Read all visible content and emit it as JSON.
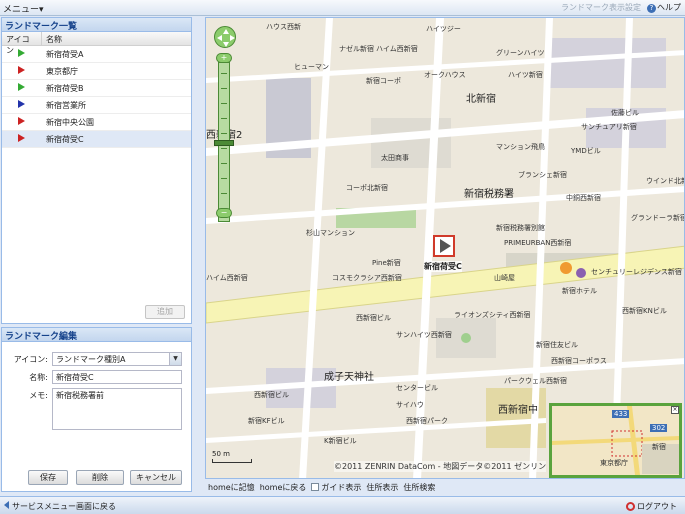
{
  "menubar": {
    "menu_label": "メニュー▾",
    "landmark_settings": "ランドマーク表示設定",
    "help": "ヘルプ",
    "help_glyph": "?"
  },
  "landmark_list": {
    "title": "ランドマーク一覧",
    "col_icon": "アイコン",
    "col_name": "名称",
    "rows": [
      {
        "name": "新宿荷受A",
        "color": "#33aa33"
      },
      {
        "name": "東京都庁",
        "color": "#cc2222"
      },
      {
        "name": "新宿荷受B",
        "color": "#33aa33"
      },
      {
        "name": "新宿営業所",
        "color": "#2233aa"
      },
      {
        "name": "新宿中央公園",
        "color": "#cc2222"
      },
      {
        "name": "新宿荷受C",
        "color": "#cc2222"
      }
    ],
    "add_button": "追加"
  },
  "landmark_edit": {
    "title": "ランドマーク編集",
    "icon_label": "アイコン:",
    "icon_value": "ランドマーク種別A",
    "name_label": "名称:",
    "name_value": "新宿荷受C",
    "memo_label": "メモ:",
    "memo_value": "新宿税務署前",
    "save": "保存",
    "delete": "削除",
    "cancel": "キャンセル"
  },
  "map": {
    "marker_label": "新宿荷受C",
    "copyright": "©2011 ZENRIN DataCom - 地図データ©2011 ゼンリン",
    "scale": "50 m",
    "overview_number1": "433",
    "overview_number2": "302",
    "overview_label1": "東京都庁",
    "overview_label2": "新宿",
    "overview_close": "×",
    "labels": {
      "l1": "新宿税務署",
      "l2": "西新宿中",
      "l3": "成子天神社",
      "l4": "ハウス西新",
      "l5": "ナゼル新宿",
      "l6": "ハイム西新宿",
      "l7": "ハイツジー",
      "l8": "グリーンハイツ",
      "l9": "ハイツ新宿",
      "l10": "北新宿",
      "l11": "ヒューマン",
      "l12": "新宿コーポ",
      "l13": "太田商事",
      "l14": "コーポ北新宿",
      "l15": "新宿税務署別館",
      "l16": "PRIMEURBAN西新宿",
      "l17": "杉山マンション",
      "l18": "Pine新宿",
      "l19": "コスモクラシア西新宿",
      "l20": "山崎屋",
      "l21": "センチュリーレジデンス新宿",
      "l22": "新宿ホテル",
      "l23": "西新宿KNビル",
      "l24": "サンハイツ西新宿",
      "l25": "西新宿ビル",
      "l26": "ライオンズシティ西新宿",
      "l27": "新宿住友ビル",
      "l28": "サンチュアリ新宿",
      "l29": "佐藤ビル",
      "l30": "YMDビル",
      "l31": "ウインド北新宿",
      "l32": "グランドーラ新宿",
      "l33": "中銅西新宿",
      "l34": "センタービル",
      "l35": "ハイム西新宿",
      "l36": "オークハウス",
      "l37": "マンション飛鳥",
      "l38": "ブランシェ新宿",
      "l39": "パークウェル西新宿",
      "l40": "西新宿コーポラス",
      "l41": "新宿KFビル",
      "l42": "西新宿ビル",
      "l43": "サイハウ",
      "l44": "K新宿ビル",
      "l45": "西新宿パーク",
      "l46": "西新宿2"
    }
  },
  "map_toolbar": {
    "home_memory": "homeに記憶",
    "home_return": "homeに戻る",
    "guide": "ガイド表示",
    "address_show": "住所表示",
    "address_search": "住所検索"
  },
  "statusbar": {
    "back": "サービスメニュー画面に戻る",
    "logout": "ログアウト"
  }
}
